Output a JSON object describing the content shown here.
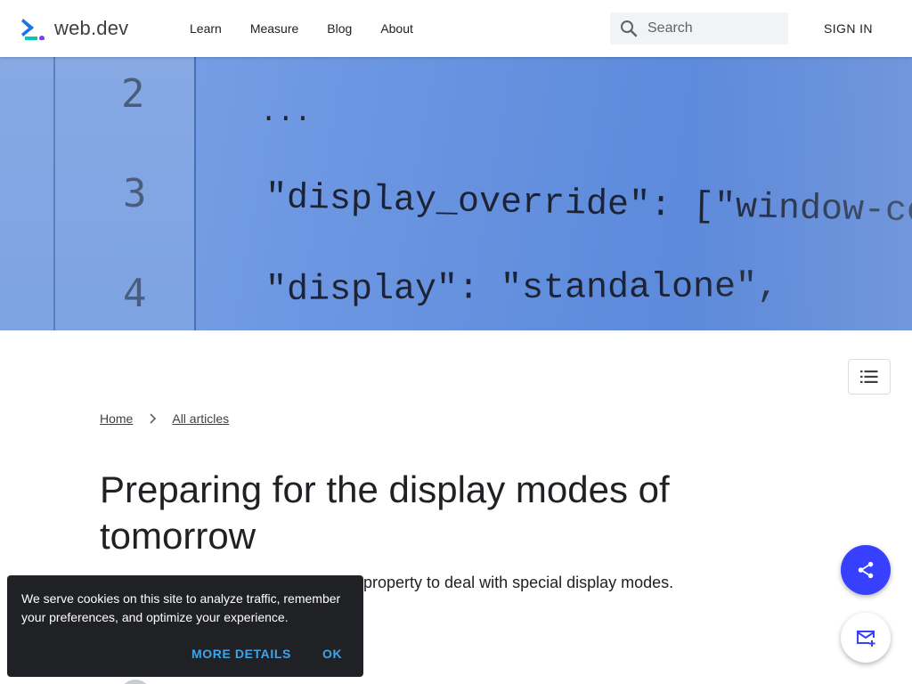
{
  "header": {
    "logo_text": "web.dev",
    "nav": [
      "Learn",
      "Measure",
      "Blog",
      "About"
    ],
    "search_placeholder": "Search",
    "signin_label": "SIGN IN"
  },
  "hero": {
    "line_numbers": [
      "2",
      "3",
      "4"
    ],
    "code_lines": [
      "...",
      "\"display_override\": [\"window-control-over",
      "\"display\": \"standalone\","
    ]
  },
  "article": {
    "breadcrumb": [
      "Home",
      "All articles"
    ],
    "title": "Preparing for the display modes of tomorrow",
    "subtitle": "property to deal with special display modes."
  },
  "cookie": {
    "text": "We serve cookies on this site to analyze traffic, remember your preferences, and optimize your experience.",
    "more_label": "MORE DETAILS",
    "ok_label": "OK"
  },
  "colors": {
    "brand": "#3740ff",
    "cookie_bg": "#202124",
    "cookie_action": "#3fa4e8"
  },
  "icons": [
    "web-dev-logo-icon",
    "search-icon",
    "chevron-right-icon",
    "list-icon",
    "share-icon",
    "mail-add-icon"
  ]
}
